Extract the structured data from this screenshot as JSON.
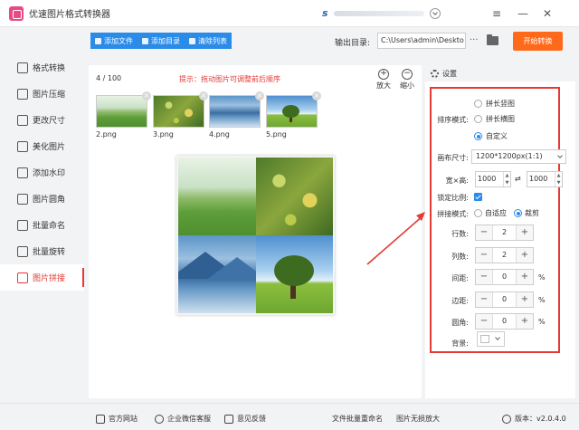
{
  "app": {
    "title": "优速图片格式转换器",
    "user_initial": "s"
  },
  "window": {
    "menu": "≡",
    "minimize": "—",
    "close": "✕"
  },
  "sidebar": {
    "items": [
      {
        "label": "格式转换"
      },
      {
        "label": "图片压缩"
      },
      {
        "label": "更改尺寸"
      },
      {
        "label": "美化图片"
      },
      {
        "label": "添加水印"
      },
      {
        "label": "图片圆角"
      },
      {
        "label": "批量命名"
      },
      {
        "label": "批量旋转"
      },
      {
        "label": "图片拼接",
        "active": true
      }
    ]
  },
  "toolbar": {
    "add_file": "添加文件",
    "add_folder": "添加目录",
    "clear_list": "清除列表",
    "output_label": "输出目录:",
    "output_path": "C:\\Users\\admin\\Deskto",
    "browse": "···",
    "start": "开始转换"
  },
  "workspace": {
    "count": "4 / 100",
    "hint": "提示：拖动图片可调整前后顺序",
    "zoom_in": "放大",
    "zoom_out": "缩小",
    "thumbnails": [
      {
        "name": "2.png",
        "image": "green-field"
      },
      {
        "name": "3.png",
        "image": "bokeh-flowers"
      },
      {
        "name": "4.png",
        "image": "blue-mountains"
      },
      {
        "name": "5.png",
        "image": "lone-tree"
      }
    ]
  },
  "settings": {
    "title": "设置",
    "sort_label": "排序模式:",
    "sort_options": [
      "拼长竖图",
      "拼长横图",
      "自定义"
    ],
    "sort_selected": 2,
    "canvas_label": "画布尺寸:",
    "canvas_value": "1200*1200px(1:1)",
    "wh_label": "宽×高:",
    "width": "1000",
    "height": "1000",
    "lock_label": "锁定比例:",
    "lock_checked": true,
    "mode_label": "拼接模式:",
    "mode_options": [
      "自适应",
      "裁剪"
    ],
    "mode_selected": 1,
    "rows_label": "行数:",
    "rows": "2",
    "cols_label": "列数:",
    "cols": "2",
    "spacing_label": "间距:",
    "spacing": "0",
    "margin_label": "边距:",
    "margin": "0",
    "radius_label": "圆角:",
    "radius": "0",
    "unit": "%",
    "bg_label": "背景:",
    "bg_color": "#ffffff"
  },
  "footer": {
    "website": "官方网站",
    "wechat": "企业微信客服",
    "feedback": "意见反馈",
    "batch_rename": "文件批量重命名",
    "lossless_zoom": "图片无损放大",
    "version": "版本：v2.0.4.0"
  },
  "colors": {
    "accent": "#2a8be8",
    "danger": "#e53935",
    "start": "#ff6a1a"
  }
}
